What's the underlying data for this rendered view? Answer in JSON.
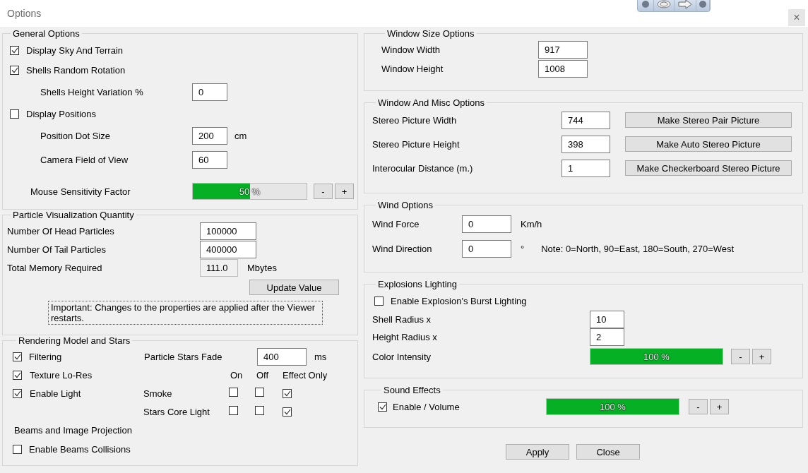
{
  "window": {
    "title": "Options",
    "close": "×"
  },
  "general": {
    "title": "General Options",
    "rows": [
      {
        "kind": "check",
        "label": "Display Sky And Terrain",
        "checked": true
      },
      {
        "kind": "check",
        "label": "Shells Random Rotation",
        "checked": true,
        "children": [
          {
            "kind": "field",
            "label": "Shells Height Variation %",
            "value": "0"
          }
        ]
      },
      {
        "kind": "check",
        "label": "Display Positions",
        "checked": false,
        "children": [
          {
            "kind": "field",
            "label": "Position Dot Size",
            "value": "200",
            "unit": "cm"
          },
          {
            "kind": "field",
            "label": "Camera Field of View",
            "value": "60"
          }
        ]
      },
      {
        "kind": "meter",
        "label": "Mouse Sensitivity Factor",
        "level": 0.5,
        "reading": "50 %",
        "buttons": [
          "-",
          "+"
        ]
      }
    ]
  },
  "particles": {
    "title": "Particle Visualization Quantity",
    "fields": [
      {
        "label": "Number Of Head Particles",
        "value": "100000",
        "read_only": false
      },
      {
        "label": "Number Of Tail Particles",
        "value": "400000",
        "read_only": false
      },
      {
        "label": "Total Memory Required",
        "value": "111.0",
        "unit": "Mbytes",
        "read_only": true
      }
    ],
    "update_button": "Update Value",
    "note": "Important: Changes to the properties are applied after the Viewer restarts."
  },
  "rendering": {
    "title": "Rendering Model and Stars",
    "options": [
      {
        "label": "Filtering",
        "checked": true
      },
      {
        "label": "Texture Lo-Res",
        "checked": true
      },
      {
        "label": "Enable Light",
        "checked": true
      }
    ],
    "stars_fade": {
      "label": "Particle Stars Fade",
      "value": "400",
      "unit": "ms"
    },
    "mode_columns": [
      "On",
      "Off",
      "Effect Only"
    ],
    "mode_rows": [
      {
        "label": "Smoke",
        "choices": [
          {
            "checked": false
          },
          {
            "checked": false
          },
          {
            "checked": true
          }
        ]
      },
      {
        "label": "Stars Core Light",
        "choices": [
          {
            "checked": false
          },
          {
            "checked": false
          },
          {
            "checked": true
          }
        ]
      }
    ],
    "beams_title": "Beams and Image Projection",
    "beams_collisions": {
      "label": "Enable Beams Collisions",
      "checked": false
    }
  },
  "window_size": {
    "title": "Window Size Options",
    "fields": [
      {
        "label": "Window Width",
        "value": "917"
      },
      {
        "label": "Window Height",
        "value": "1008"
      }
    ]
  },
  "misc": {
    "title": "Window And Misc Options",
    "rows": [
      {
        "label": "Stereo Picture Width",
        "value": "744",
        "button": "Make Stereo Pair Picture"
      },
      {
        "label": "Stereo Picture Height",
        "value": "398",
        "button": "Make Auto Stereo Picture"
      },
      {
        "label": "Interocular Distance (m.)",
        "value": "1",
        "button": "Make Checkerboard Stereo Picture"
      }
    ]
  },
  "wind": {
    "title": "Wind Options",
    "rows": [
      {
        "label": "Wind Force",
        "value": "0",
        "unit": "Km/h"
      },
      {
        "label": "Wind Direction",
        "value": "0",
        "unit": "°",
        "note": "Note: 0=North, 90=East, 180=South, 270=West"
      }
    ]
  },
  "explosions": {
    "title": "Explosions Lighting",
    "burst": {
      "label": "Enable Explosion's Burst Lighting",
      "checked": false
    },
    "fields": [
      {
        "label": "Shell Radius x",
        "value": "10"
      },
      {
        "label": "Height Radius x",
        "value": "2"
      }
    ],
    "intensity": {
      "label": "Color Intensity",
      "level": 1,
      "reading": "100 %",
      "buttons": [
        "-",
        "+"
      ]
    }
  },
  "sound": {
    "title": "Sound Effects",
    "enable": {
      "label": "Enable / Volume",
      "checked": true
    },
    "volume": {
      "level": 1,
      "reading": "100 %",
      "buttons": [
        "-",
        "+"
      ]
    }
  },
  "footer": [
    "Apply",
    "Close"
  ]
}
